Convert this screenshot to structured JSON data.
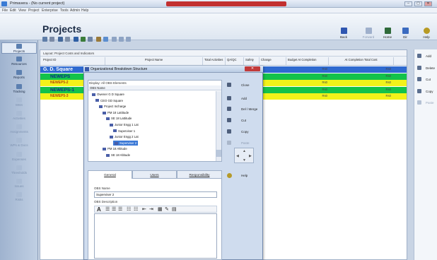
{
  "window": {
    "title": "Primavera - (No current project)",
    "controls": [
      "–",
      "▢",
      "✕"
    ]
  },
  "menu": [
    "File",
    "Edit",
    "View",
    "Project",
    "Enterprise",
    "Tools",
    "Admin",
    "Help"
  ],
  "header": {
    "title": "Projects",
    "nav_buttons": [
      {
        "label": "Back",
        "icon": "back-arrow-icon"
      },
      {
        "label": "Forward",
        "icon": "forward-arrow-icon"
      },
      {
        "label": "Home",
        "icon": "home-icon"
      },
      {
        "label": "Dir",
        "icon": "directory-icon"
      },
      {
        "label": "Help",
        "icon": "help-icon"
      }
    ]
  },
  "leftnav": [
    {
      "label": "Projects",
      "active": true
    },
    {
      "label": "Resources",
      "active": false
    },
    {
      "label": "Reports",
      "active": false
    },
    {
      "label": "Tracking",
      "active": false
    },
    {
      "label": "WBS",
      "active": false
    },
    {
      "label": "Activities",
      "active": false
    },
    {
      "label": "Assignments",
      "active": false
    },
    {
      "label": "WPs & Docs",
      "active": false
    },
    {
      "label": "Expenses",
      "active": false
    },
    {
      "label": "Thresholds",
      "active": false
    },
    {
      "label": "Issues",
      "active": false
    },
    {
      "label": "Risks",
      "active": false
    }
  ],
  "grid": {
    "layout": "Layout: Project Costs and Indicators",
    "columns": [
      "Project ID",
      "Project Name",
      "Total Activities",
      "QA/QC",
      "Safety",
      "Change",
      "Budget At Completion",
      "At Completion Total Cost"
    ],
    "rows": [
      {
        "id": "G. D. Square",
        "color": "#2f6ad0",
        "text": "#ffffff",
        "bac": "Rs0",
        "acc": "Rs0"
      },
      {
        "id": "NEWEPS",
        "color": "#13c24a",
        "text": "#0b2a8a",
        "bac": "Rs0",
        "acc": "Rs0"
      },
      {
        "id": "NEWEP5-2",
        "color": "#f2f21a",
        "text": "#b5420c",
        "bac": "Rs0",
        "acc": "Rs0"
      },
      {
        "id": "NEWEPS-1",
        "color": "#13c24a",
        "text": "#0b2a8a",
        "bac": "Rs0",
        "acc": "Rs0"
      },
      {
        "id": "NEWEP5-3",
        "color": "#f2f21a",
        "text": "#b5420c",
        "bac": "Rs0",
        "acc": "Rs0"
      }
    ]
  },
  "rightpanel": [
    {
      "label": "Add",
      "enabled": true
    },
    {
      "label": "Delete",
      "enabled": true
    },
    {
      "label": "Cut",
      "enabled": true
    },
    {
      "label": "Copy",
      "enabled": true
    },
    {
      "label": "Paste",
      "enabled": false
    }
  ],
  "dialog": {
    "title": "Organizational Breakdown Structure",
    "display": "Display: All OBS Elements",
    "tree_header": "OBS Name",
    "tree": [
      {
        "label": "Owener G D Square",
        "depth": 0
      },
      {
        "label": "CEO GD Square",
        "depth": 1
      },
      {
        "label": "Project Incharge",
        "depth": 2
      },
      {
        "label": "PM 18 Lattitude",
        "depth": 3
      },
      {
        "label": "SE 18 Lattitude",
        "depth": 4
      },
      {
        "label": "Junior Engg 1 Lat",
        "depth": 5
      },
      {
        "label": "Superviser 1",
        "depth": 6
      },
      {
        "label": "Junior Engg 2 Lat",
        "depth": 5
      },
      {
        "label": "Superviser 2",
        "depth": 6,
        "selected": true
      },
      {
        "label": "PM 18 Altitude",
        "depth": 3
      },
      {
        "label": "SE 18 Altitude",
        "depth": 4
      }
    ],
    "buttons": [
      {
        "label": "Close",
        "enabled": true
      },
      {
        "label": "Add",
        "enabled": true
      },
      {
        "label": "Del / Merge",
        "enabled": true
      },
      {
        "label": "Cut",
        "enabled": true
      },
      {
        "label": "Copy",
        "enabled": true
      },
      {
        "label": "Paste",
        "enabled": false
      }
    ],
    "help_label": "Help",
    "tabs": [
      "General",
      "Users",
      "Responsibility"
    ],
    "obs_name_label": "OBS Name",
    "obs_name_value": "Superviser 2",
    "obs_desc_label": "OBS Description"
  }
}
